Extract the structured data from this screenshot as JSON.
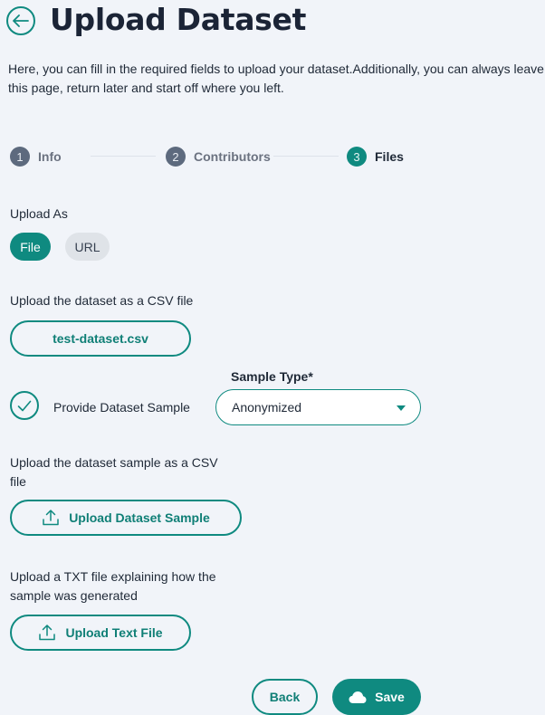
{
  "header": {
    "title": "Upload Dataset",
    "description": "Here, you can fill in the required fields to upload your dataset.Additionally, you can always leave this page, return later and start off where you left."
  },
  "stepper": {
    "steps": [
      {
        "number": "1",
        "label": "Info",
        "state": "inactive"
      },
      {
        "number": "2",
        "label": "Contributors",
        "state": "inactive"
      },
      {
        "number": "3",
        "label": "Files",
        "state": "active"
      }
    ]
  },
  "upload_as": {
    "label": "Upload As",
    "options": [
      "File",
      "URL"
    ],
    "selected": "File"
  },
  "dataset_file": {
    "label": "Upload the dataset as a CSV file",
    "file_name": "test-dataset.csv"
  },
  "sample": {
    "checkbox_label": "Provide Dataset Sample",
    "checked": true,
    "type_label": "Sample Type*",
    "type_value": "Anonymized",
    "upload_label": "Upload the dataset sample as a CSV file",
    "upload_button": "Upload Dataset Sample",
    "text_label": "Upload a TXT file explaining how the sample was generated",
    "text_button": "Upload Text File"
  },
  "footer": {
    "back_label": "Back",
    "save_label": "Save"
  },
  "icons": {
    "back": "arrow-left-circle-icon",
    "check": "check-circle-icon",
    "upload": "upload-icon",
    "cloud": "cloud-icon",
    "caret": "caret-down-icon"
  },
  "colors": {
    "accent": "#0f8a80",
    "background": "#f1f4f9",
    "inactive_step": "#5d6a7e"
  }
}
